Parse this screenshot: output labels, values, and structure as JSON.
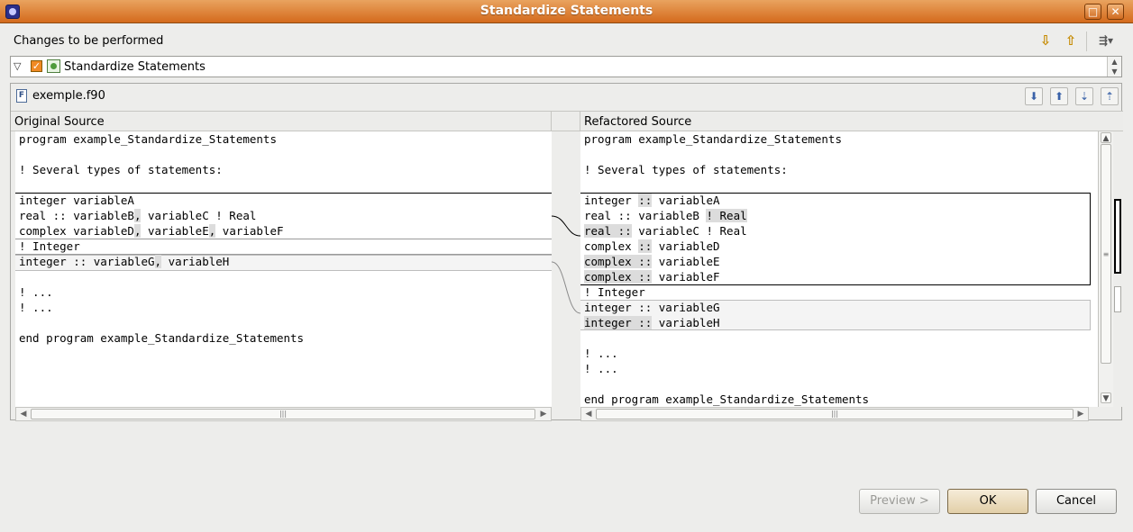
{
  "window": {
    "title": "Standardize Statements",
    "maximize_label": "□",
    "close_label": "✕"
  },
  "changes": {
    "label": "Changes to be performed",
    "tree_item": "Standardize Statements",
    "icons": [
      "next-change-down-icon",
      "previous-change-up-icon",
      "filter-changes-icon"
    ]
  },
  "compare": {
    "file_name": "exemple.f90",
    "left_header": "Original Source",
    "right_header": "Refactored Source",
    "nav_icons": [
      "next-difference-icon",
      "previous-difference-icon",
      "next-change-icon",
      "previous-change-icon"
    ],
    "left_lines": [
      "program example_Standardize_Statements",
      "",
      "! Several types of statements:",
      "",
      "integer variableA",
      "real :: variableB, variableC ! Real",
      "complex variableD, variableE, variableF",
      "! Integer",
      "integer :: variableG, variableH",
      "",
      "! ...",
      "! ...",
      "",
      "end program example_Standardize_Statements"
    ],
    "right_lines": [
      "program example_Standardize_Statements",
      "",
      "! Several types of statements:",
      "",
      "integer :: variableA",
      "real :: variableB ! Real",
      "real :: variableC ! Real",
      "complex :: variableD",
      "complex :: variableE",
      "complex :: variableF",
      "! Integer",
      "integer :: variableG",
      "integer :: variableH",
      "",
      "! ...",
      "! ...",
      "",
      "end program example_Standardize_Statements"
    ]
  },
  "buttons": {
    "preview": "Preview >",
    "ok": "OK",
    "cancel": "Cancel"
  },
  "colors": {
    "titlebar": "#d46a1c",
    "highlight": "#dcdcdc",
    "change_border": "#000000"
  }
}
